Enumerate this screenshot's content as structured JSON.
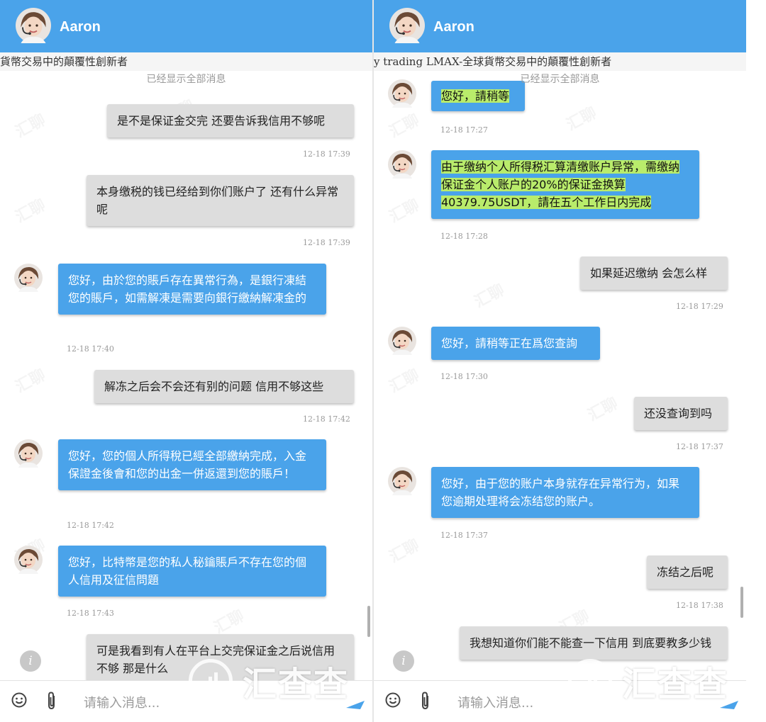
{
  "header": {
    "name": "Aaron"
  },
  "left": {
    "marquee": "貨幣交易中的顛覆性創新者",
    "all_shown": "已经显示全部消息",
    "messages": [
      {
        "text": "是不是保证金交完 还要告诉我信用不够呢",
        "time": "12-18 17:39"
      },
      {
        "text": "本身缴税的钱已经给到你们账户了 还有什么异常呢",
        "time": "12-18 17:39"
      },
      {
        "text": "您好，由於您的賬戶存在異常行為，是銀行凍結您的賬戶，如需解凍是需要向銀行繳納解凍金的",
        "time": "12-18 17:40"
      },
      {
        "text": "解冻之后会不会还有别的问题 信用不够这些",
        "time": "12-18 17:42"
      },
      {
        "text": "您好，您的個人所得稅已經全部繳納完成，入金保證金後會和您的出金一併返還到您的賬戶！",
        "time": "12-18 17:42"
      },
      {
        "text": "您好，比特幣是您的私人秘鑰賬戶不存在您的個人信用及征信問題",
        "time": "12-18 17:43"
      },
      {
        "text": "可是我看到有人在平台上交完保证金之后说信用不够 那是什么"
      }
    ]
  },
  "right": {
    "marquee": "y trading LMAX-全球貨幣交易中的顛覆性創新者",
    "all_shown": "已经显示全部消息",
    "messages": [
      {
        "text": "您好，請稍等",
        "time": "12-18 17:27"
      },
      {
        "text": "由于缴纳个人所得税汇算清缴账户异常，需缴纳保证金个人账户的20%的保证金换算40379.75USDT，請在五个工作日内完成",
        "time": "12-18 17:28"
      },
      {
        "text": "如果延迟缴纳 会怎么样",
        "time": "12-18 17:29"
      },
      {
        "text": "您好，請稍等正在爲您查詢",
        "time": "12-18 17:30"
      },
      {
        "text": "还没查询到吗",
        "time": "12-18 17:37"
      },
      {
        "text": "您好，由于您的账户本身就存在异常行为，如果您逾期处理将会冻结您的账户。",
        "time": "12-18 17:37"
      },
      {
        "text": "冻结之后呢",
        "time": "12-18 17:38"
      },
      {
        "text": "我想知道你们能不能查一下信用 到底要教多少钱"
      }
    ]
  },
  "input": {
    "placeholder": "请输入消息..."
  },
  "brand": {
    "text": "汇查查"
  },
  "watermark": {
    "text": "汇聊"
  },
  "icons": {
    "info": "info-icon",
    "emoji": "smiley-icon",
    "attach": "paperclip-icon",
    "send": "send-icon"
  },
  "colors": {
    "accent": "#4aa3ea",
    "outgoing_bubble": "#dddddd",
    "highlight": "#b9ec6b"
  }
}
